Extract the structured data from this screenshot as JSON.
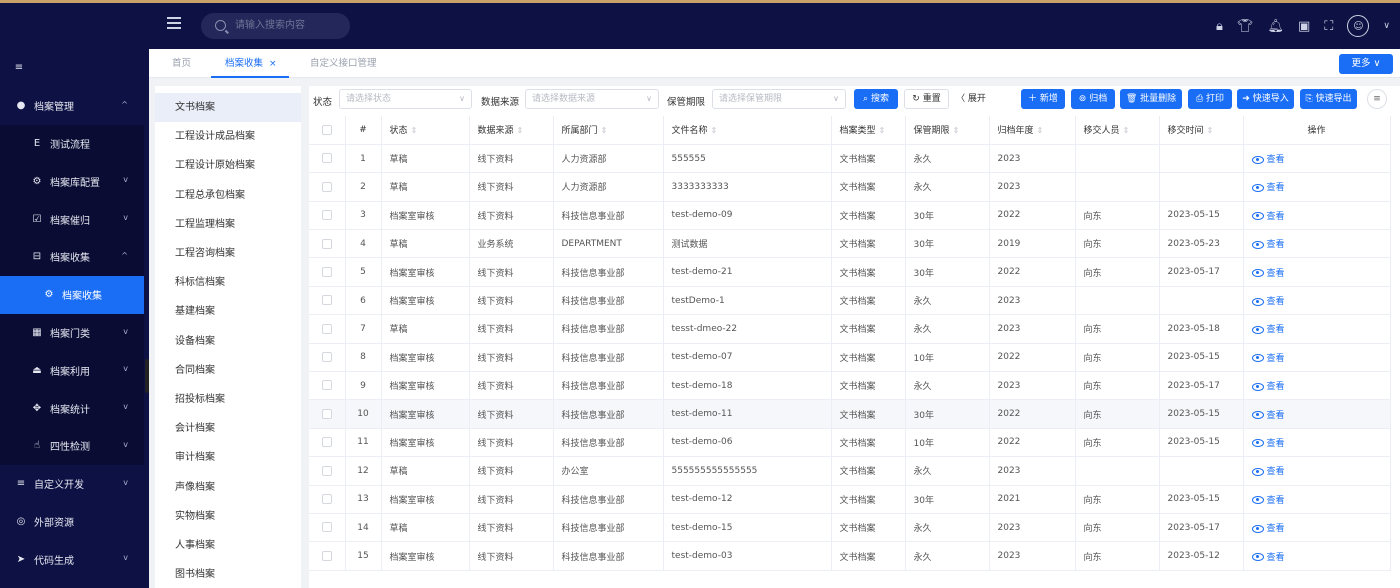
{
  "header": {
    "search_placeholder": "请输入搜索内容",
    "icons": [
      "lock-icon",
      "shirt-icon",
      "bell-icon",
      "translate-icon",
      "fullscreen-icon",
      "avatar-icon"
    ]
  },
  "sidebar": {
    "items": [
      {
        "label": "档案管理",
        "icon": "folder-icon",
        "chevron": "^"
      },
      {
        "label": "测试流程",
        "icon": "e-icon",
        "chevron": ""
      },
      {
        "label": "档案库配置",
        "icon": "gears-icon",
        "chevron": "v"
      },
      {
        "label": "档案催归",
        "icon": "check-square-icon",
        "chevron": "v"
      },
      {
        "label": "档案收集",
        "icon": "minus-square-icon",
        "chevron": "^"
      },
      {
        "label": "档案收集",
        "icon": "gear-icon",
        "chevron": ""
      },
      {
        "label": "档案门类",
        "icon": "calendar-icon",
        "chevron": "v"
      },
      {
        "label": "档案利用",
        "icon": "eject-icon",
        "chevron": "v"
      },
      {
        "label": "档案统计",
        "icon": "arrows-icon",
        "chevron": "v"
      },
      {
        "label": "四性检测",
        "icon": "hand-icon",
        "chevron": "v"
      },
      {
        "label": "自定义开发",
        "icon": "list-icon",
        "chevron": "v"
      },
      {
        "label": "外部资源",
        "icon": "circle-icon",
        "chevron": ""
      },
      {
        "label": "代码生成",
        "icon": "send-icon",
        "chevron": "v"
      }
    ]
  },
  "tabs": {
    "items": [
      "首页",
      "档案收集",
      "自定义接口管理"
    ],
    "close": "×",
    "more": "更多 ∨"
  },
  "categories": [
    "文书档案",
    "工程设计成品档案",
    "工程设计原始档案",
    "工程总承包档案",
    "工程监理档案",
    "工程咨询档案",
    "科标信档案",
    "基建档案",
    "设备档案",
    "合同档案",
    "招投标档案",
    "会计档案",
    "审计档案",
    "声像档案",
    "实物档案",
    "人事档案",
    "图书档案"
  ],
  "filters": {
    "status_label": "状态",
    "status_placeholder": "请选择状态",
    "source_label": "数据来源",
    "source_placeholder": "请选择数据来源",
    "period_label": "保管期限",
    "period_placeholder": "请选择保管期限",
    "search": "搜索",
    "reset": "重置",
    "expand": "〈 展开"
  },
  "toolbar": {
    "add": "＋ 新增",
    "archive": "归档",
    "batch_delete": "批量删除",
    "print": "打印",
    "quick_import": "快速导入",
    "quick_export": "快速导出"
  },
  "table": {
    "headers": [
      "#",
      "状态",
      "数据来源",
      "所属部门",
      "文件名称",
      "档案类型",
      "保管期限",
      "归档年度",
      "移交人员",
      "移交时间",
      "操作"
    ],
    "view_label": "查看",
    "rows": [
      [
        "1",
        "草稿",
        "线下资料",
        "人力资源部",
        "555555",
        "文书档案",
        "永久",
        "2023",
        "",
        ""
      ],
      [
        "2",
        "草稿",
        "线下资料",
        "人力资源部",
        "3333333333",
        "文书档案",
        "永久",
        "2023",
        "",
        ""
      ],
      [
        "3",
        "档案室审核",
        "线下资料",
        "科技信息事业部",
        "test-demo-09",
        "文书档案",
        "30年",
        "2022",
        "向东",
        "2023-05-15"
      ],
      [
        "4",
        "草稿",
        "业务系统",
        "DEPARTMENT",
        "测试数据",
        "文书档案",
        "30年",
        "2019",
        "向东",
        "2023-05-23"
      ],
      [
        "5",
        "档案室审核",
        "线下资料",
        "科技信息事业部",
        "test-demo-21",
        "文书档案",
        "30年",
        "2022",
        "向东",
        "2023-05-17"
      ],
      [
        "6",
        "档案室审核",
        "线下资料",
        "科技信息事业部",
        "testDemo-1",
        "文书档案",
        "永久",
        "2023",
        "",
        ""
      ],
      [
        "7",
        "草稿",
        "线下资料",
        "科技信息事业部",
        "tesst-dmeo-22",
        "文书档案",
        "永久",
        "2023",
        "向东",
        "2023-05-18"
      ],
      [
        "8",
        "档案室审核",
        "线下资料",
        "科技信息事业部",
        "test-demo-07",
        "文书档案",
        "10年",
        "2022",
        "向东",
        "2023-05-15"
      ],
      [
        "9",
        "档案室审核",
        "线下资料",
        "科技信息事业部",
        "test-demo-18",
        "文书档案",
        "永久",
        "2023",
        "向东",
        "2023-05-17"
      ],
      [
        "10",
        "档案室审核",
        "线下资料",
        "科技信息事业部",
        "test-demo-11",
        "文书档案",
        "30年",
        "2022",
        "向东",
        "2023-05-15"
      ],
      [
        "11",
        "档案室审核",
        "线下资料",
        "科技信息事业部",
        "test-demo-06",
        "文书档案",
        "10年",
        "2022",
        "向东",
        "2023-05-15"
      ],
      [
        "12",
        "草稿",
        "线下资料",
        "办公室",
        "555555555555555",
        "文书档案",
        "永久",
        "2023",
        "",
        ""
      ],
      [
        "13",
        "档案室审核",
        "线下资料",
        "科技信息事业部",
        "test-demo-12",
        "文书档案",
        "30年",
        "2021",
        "向东",
        "2023-05-15"
      ],
      [
        "14",
        "草稿",
        "线下资料",
        "科技信息事业部",
        "test-demo-15",
        "文书档案",
        "永久",
        "2023",
        "向东",
        "2023-05-17"
      ],
      [
        "15",
        "档案室审核",
        "线下资料",
        "科技信息事业部",
        "test-demo-03",
        "文书档案",
        "永久",
        "2023",
        "向东",
        "2023-05-12"
      ]
    ]
  }
}
